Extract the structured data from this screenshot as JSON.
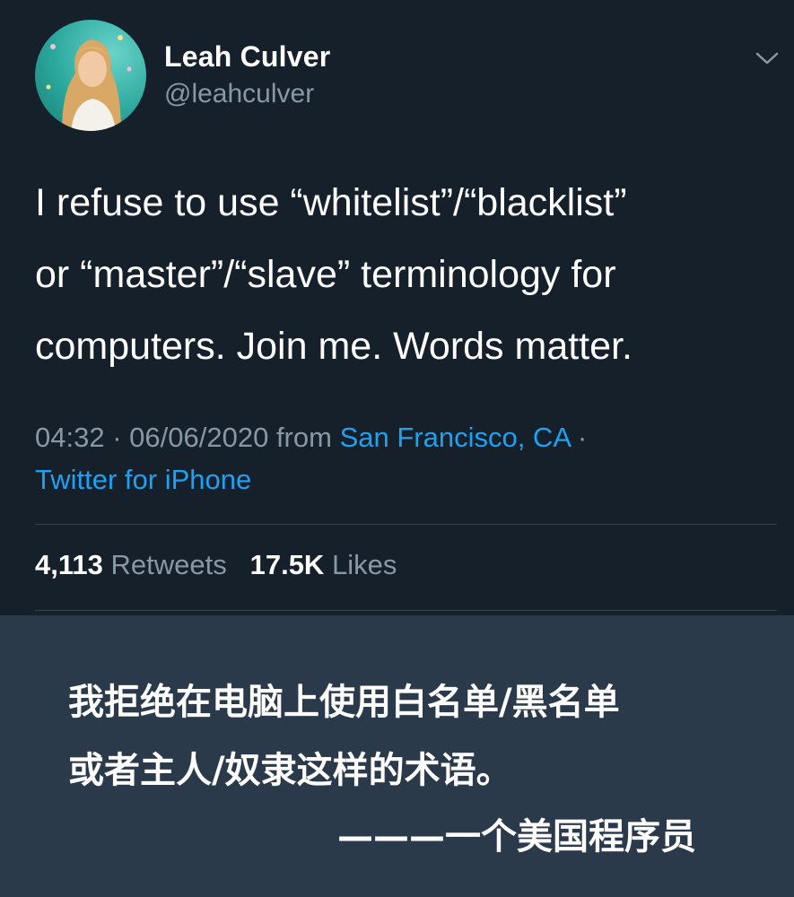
{
  "tweet": {
    "author": {
      "name": "Leah Culver",
      "handle": "@leahculver"
    },
    "body": {
      "line1": "I refuse to use “whitelist”/“blacklist”",
      "line2": "or “master”/“slave” terminology for",
      "line3": "computers. Join me. Words matter."
    },
    "meta": {
      "time": "04:32",
      "separator": "·",
      "date": "06/06/2020",
      "from_label": "from",
      "location": "San Francisco, CA",
      "client": "Twitter for iPhone"
    },
    "stats": {
      "retweets_count": "4,113",
      "retweets_label": "Retweets",
      "likes_count": "17.5K",
      "likes_label": "Likes"
    },
    "menu_icon": "chevron-down-icon"
  },
  "caption": {
    "line1": "我拒绝在电脑上使用白名单/黑名单",
    "line2": "或者主人/奴隶这样的术语。",
    "signature": "———一个美国程序员"
  },
  "colors": {
    "background": "#15202b",
    "caption_background": "#2b3a4a",
    "text_primary": "#ffffff",
    "text_secondary": "#8899a6",
    "link": "#1da1f2",
    "divider": "#38444d"
  }
}
